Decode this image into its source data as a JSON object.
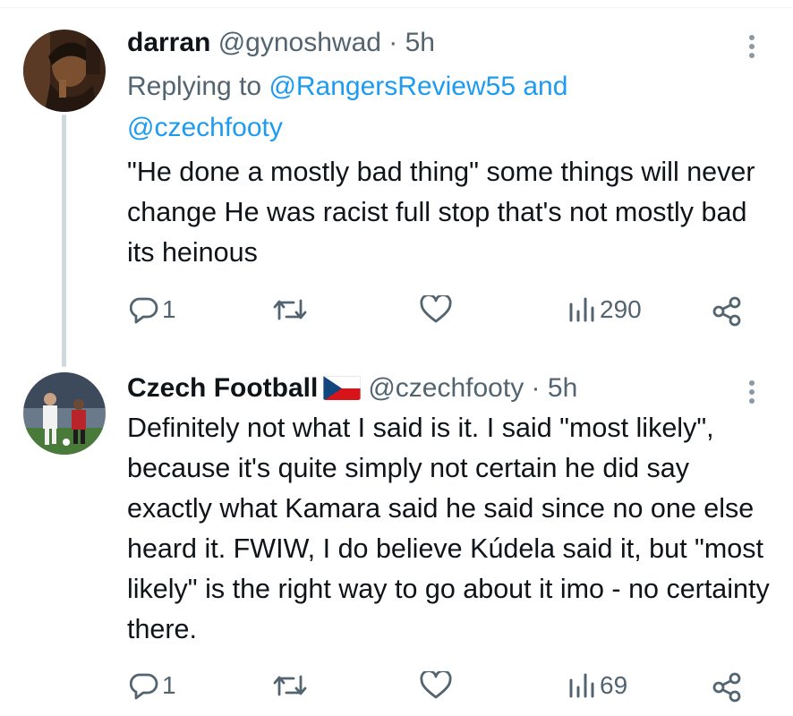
{
  "tweets": [
    {
      "display_name": "darran",
      "handle": "@gynoshwad",
      "separator": " · ",
      "time": "5h",
      "reply_prefix": "Replying to ",
      "reply_user1": "@RangersReview55",
      "reply_and": " and",
      "reply_user2": "@czechfooty",
      "text": "\"He done a mostly bad thing\" some things will never change He was racist full stop that's not mostly bad its heinous",
      "actions": {
        "replies": "1",
        "retweets": "",
        "likes": "",
        "views": "290"
      }
    },
    {
      "display_name": "Czech Football",
      "handle": "@czechfooty",
      "separator": " · ",
      "time": "5h",
      "text": "Definitely not what I said is it. I said \"most likely\", because it's quite simply not certain he did say exactly what Kamara said he said since no one else heard it. FWIW, I do believe Kúdela said it, but \"most likely\" is the right way to go about it imo - no certainty there.",
      "actions": {
        "replies": "1",
        "retweets": "",
        "likes": "",
        "views": "69"
      }
    }
  ],
  "colors": {
    "text": "#0f1419",
    "secondary": "#536471",
    "link": "#1d9bf0",
    "thread_line": "#cfd9de"
  },
  "icons": [
    "reply-icon",
    "retweet-icon",
    "like-icon",
    "views-icon",
    "share-icon",
    "more-icon",
    "czech-flag-icon"
  ]
}
